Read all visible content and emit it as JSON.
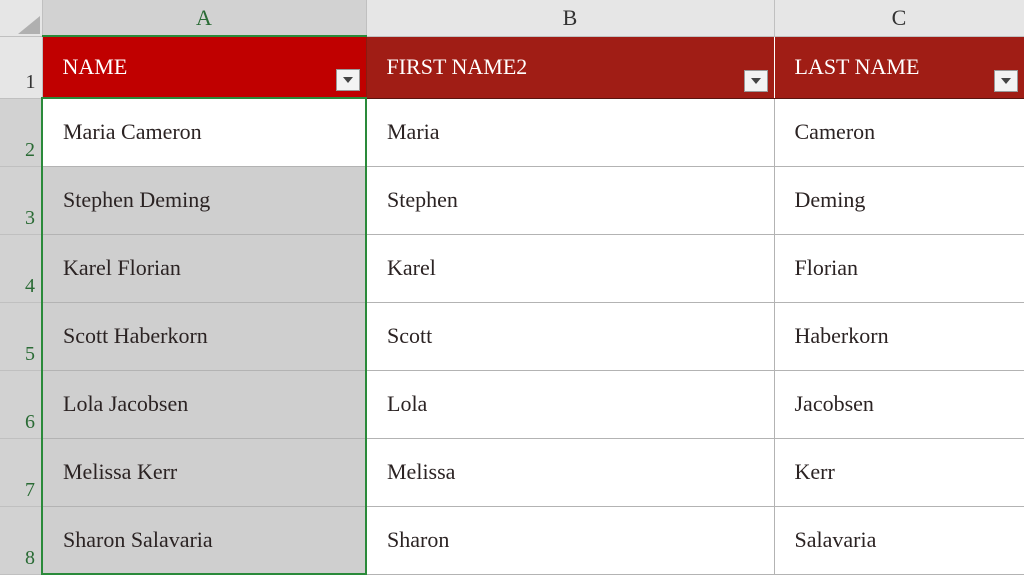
{
  "columns": {
    "A": "A",
    "B": "B",
    "C": "C"
  },
  "row_numbers": [
    "1",
    "2",
    "3",
    "4",
    "5",
    "6",
    "7",
    "8"
  ],
  "headers": {
    "A": "NAME",
    "B": "FIRST NAME2",
    "C": "LAST NAME"
  },
  "selected_column": "A",
  "active_cell": "A2",
  "rows": [
    {
      "name": "Maria Cameron",
      "first": "Maria",
      "last": "Cameron"
    },
    {
      "name": "Stephen Deming",
      "first": "Stephen",
      "last": "Deming"
    },
    {
      "name": "Karel Florian",
      "first": "Karel",
      "last": "Florian"
    },
    {
      "name": "Scott Haberkorn",
      "first": "Scott",
      "last": "Haberkorn"
    },
    {
      "name": "Lola Jacobsen",
      "first": "Lola",
      "last": "Jacobsen"
    },
    {
      "name": "Melissa Kerr",
      "first": "Melissa",
      "last": "Kerr"
    },
    {
      "name": "Sharon Salavaria",
      "first": "Sharon",
      "last": "Salavaria"
    }
  ],
  "icons": {
    "filter": "dropdown-arrow"
  },
  "colors": {
    "header_a": "#c00000",
    "header_other": "#a01d15",
    "selection_border": "#2a8a3a",
    "selection_fill": "#cfcfcf"
  }
}
